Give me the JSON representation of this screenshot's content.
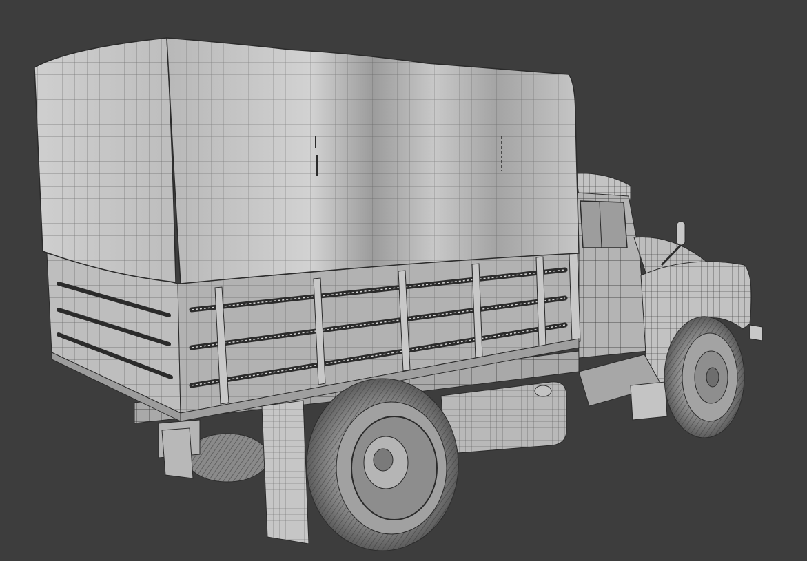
{
  "viewport": {
    "background_color": "#3d3d3d",
    "display_mode": "wireframe-over-solid",
    "subject": "truck-3d-model"
  },
  "colors": {
    "mesh_light": "#c9c9c9",
    "mesh_mid": "#a8a8a8",
    "mesh_dark": "#7c7c7c",
    "wire": "#2b2b2b",
    "shadow": "#5a5a5a"
  }
}
